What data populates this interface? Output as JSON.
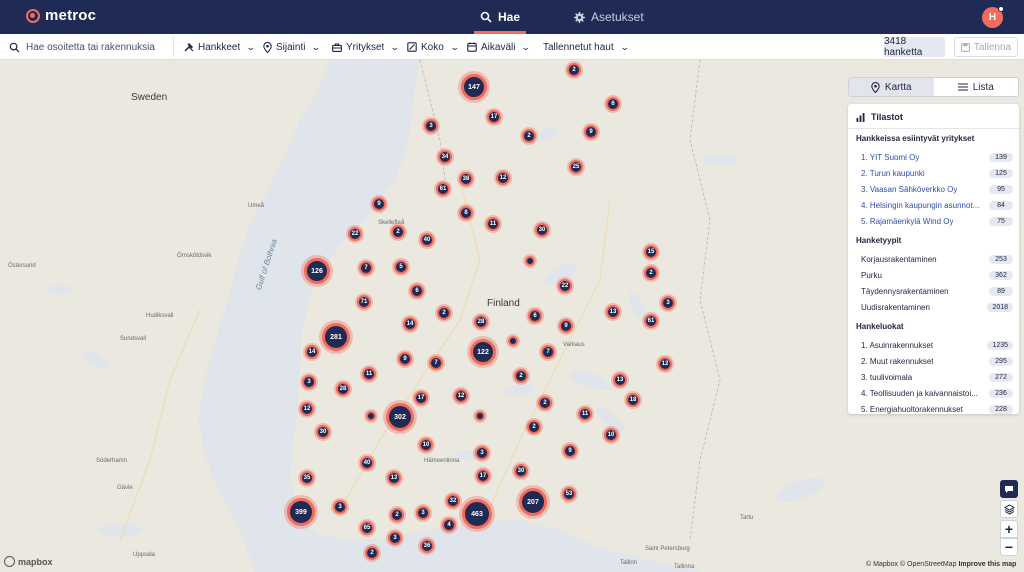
{
  "brand": {
    "name": "metroc",
    "accent": "#f26b5b",
    "navy": "#1f2a55"
  },
  "nav": {
    "tabs": [
      {
        "label": "Hae",
        "icon": "search-icon",
        "active": true
      },
      {
        "label": "Asetukset",
        "icon": "gear-icon",
        "active": false
      }
    ],
    "avatar_initial": "H"
  },
  "filters": {
    "search_placeholder": "Hae osoitetta tai rakennuksia",
    "items": [
      {
        "label": "Hankkeet",
        "icon": "tools-icon"
      },
      {
        "label": "Sijainti",
        "icon": "location-pin-icon"
      },
      {
        "label": "Yritykset",
        "icon": "briefcase-icon"
      },
      {
        "label": "Koko",
        "icon": "ruler-icon"
      },
      {
        "label": "Aikaväli",
        "icon": "calendar-icon"
      },
      {
        "label": "Tallennetut haut",
        "icon": ""
      }
    ],
    "count_label": "3418 hanketta",
    "save_label": "Tallenna"
  },
  "view_toggle": {
    "options": [
      {
        "label": "Kartta",
        "icon": "map-pin-icon",
        "active": true
      },
      {
        "label": "Lista",
        "icon": "list-icon",
        "active": false
      }
    ]
  },
  "stats": {
    "title": "Tilastot",
    "sections": [
      {
        "title": "Hankkeissa esiintyvät yritykset",
        "numbered": true,
        "link": true,
        "rows": [
          {
            "label": "YIT Suomi Oy",
            "value": "139"
          },
          {
            "label": "Turun kaupunki",
            "value": "125"
          },
          {
            "label": "Vaasan Sähköverkko Oy",
            "value": "95"
          },
          {
            "label": "Helsingin kaupungin asunnot...",
            "value": "84"
          },
          {
            "label": "Rajamäenkylä Wind Oy",
            "value": "75"
          }
        ]
      },
      {
        "title": "Hanketyypit",
        "numbered": false,
        "link": false,
        "rows": [
          {
            "label": "Korjausrakentaminen",
            "value": "253"
          },
          {
            "label": "Purku",
            "value": "362"
          },
          {
            "label": "Täydennysrakentaminen",
            "value": "89"
          },
          {
            "label": "Uudisrakentaminen",
            "value": "2018"
          }
        ]
      },
      {
        "title": "Hankeluokat",
        "numbered": true,
        "link": false,
        "rows": [
          {
            "label": "Asuinrakennukset",
            "value": "1235"
          },
          {
            "label": "Muut rakennukset",
            "value": "295"
          },
          {
            "label": "tuulivoimala",
            "value": "272"
          },
          {
            "label": "Teollisuuden ja kaivannaistoi...",
            "value": "236"
          },
          {
            "label": "Energiahuoltorakennukset",
            "value": "228"
          }
        ]
      }
    ]
  },
  "map": {
    "places": [
      {
        "name": "Sweden",
        "kind": "country"
      },
      {
        "name": "Finland",
        "kind": "country"
      },
      {
        "name": "Gulf of Bothnia",
        "kind": "sea"
      },
      {
        "name": "Umeå",
        "kind": "city"
      },
      {
        "name": "Östersund",
        "kind": "small"
      },
      {
        "name": "Örnsköldsvik",
        "kind": "small"
      },
      {
        "name": "Sundsvall",
        "kind": "city"
      },
      {
        "name": "Söderhamn",
        "kind": "small"
      },
      {
        "name": "Hudiksvall",
        "kind": "small"
      },
      {
        "name": "Gävle",
        "kind": "city"
      },
      {
        "name": "Uppsala",
        "kind": "city"
      },
      {
        "name": "Tallinn",
        "kind": "city"
      },
      {
        "name": "Tartu",
        "kind": "small"
      },
      {
        "name": "Saint Petersburg",
        "kind": "city"
      },
      {
        "name": "Tallinna",
        "kind": "small"
      },
      {
        "name": "Hämeenlinna",
        "kind": "small"
      },
      {
        "name": "Varkaus",
        "kind": "small"
      },
      {
        "name": "Skellefteå",
        "kind": "small"
      }
    ],
    "clusters": [
      "147",
      "2",
      "6",
      "17",
      "3",
      "2",
      "9",
      "34",
      "25",
      "38",
      "12",
      "61",
      "9",
      "8",
      "11",
      "22",
      "2",
      "40",
      "30",
      "126",
      "7",
      "5",
      "15",
      "2",
      "22",
      "71",
      "6",
      "14",
      "3",
      "2",
      "28",
      "6",
      "9",
      "13",
      "61",
      "281",
      "14",
      "122",
      "7",
      "9",
      "7",
      "12",
      "3",
      "11",
      "2",
      "28",
      "13",
      "12",
      "2",
      "18",
      "17",
      "302",
      "12",
      "10",
      "11",
      "30",
      "10",
      "2",
      "9",
      "3",
      "40",
      "30",
      "35",
      "13",
      "17",
      "32",
      "207",
      "53",
      "3",
      "399",
      "3",
      "4",
      "463",
      "65",
      "3",
      "2",
      "36",
      "2",
      "11"
    ],
    "dots": 4,
    "attribution": "© Mapbox © OpenStreetMap",
    "improve_label": "Improve this map",
    "logo_text": "mapbox"
  }
}
